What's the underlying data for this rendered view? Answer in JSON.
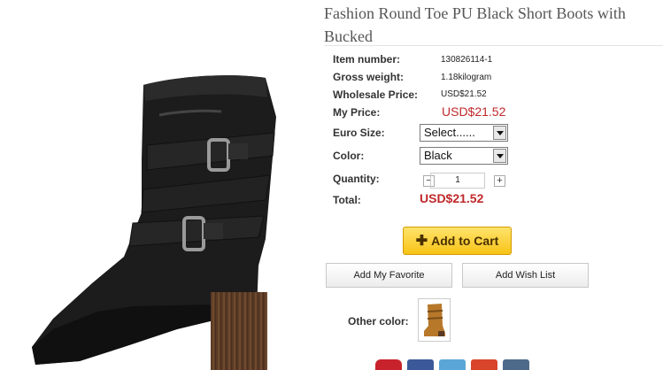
{
  "product": {
    "title": "Fashion Round Toe PU Black Short Boots with Bucked",
    "image_alt": "Black short boot with buckles",
    "details": {
      "item_number_label": "Item number:",
      "item_number": "130826114-1",
      "gross_weight_label": "Gross weight:",
      "gross_weight": "1.18kilogram",
      "wholesale_price_label": "Wholesale Price:",
      "wholesale_price": "USD$21.52",
      "my_price_label": "My Price:",
      "my_price": "USD$21.52"
    },
    "options": {
      "euro_size_label": "Euro Size:",
      "euro_size_value": "Select......",
      "color_label": "Color:",
      "color_value": "Black"
    },
    "quantity": {
      "label": "Quantity:",
      "value": "1",
      "minus": "−",
      "plus": "+"
    },
    "total": {
      "label": "Total:",
      "value": "USD$21.52"
    },
    "actions": {
      "add_to_cart": "Add to Cart",
      "add_favorite": "Add My Favorite",
      "add_wish_list": "Add Wish List"
    },
    "other_color_label": "Other color:"
  },
  "social_icons": [
    "pinterest-icon",
    "facebook-icon",
    "delicious-icon",
    "google-plus-icon",
    "share-icon"
  ],
  "colors": {
    "price_red": "#c0282b",
    "cart_yellow": "#f7c317",
    "boot_black": "#1c1c1c",
    "heel_brown": "#5a3a25",
    "swatch_tan": "#b7782a"
  }
}
